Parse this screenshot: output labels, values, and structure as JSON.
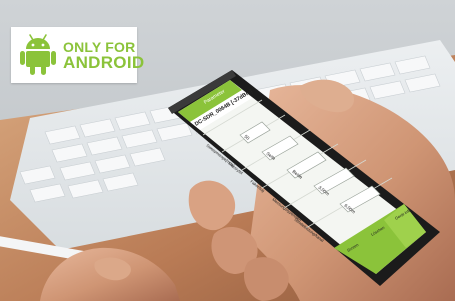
{
  "badge": {
    "line1": "ONLY FOR",
    "line2": "ANDROID",
    "color": "#8bc33a"
  },
  "phone": {
    "header_title": "Parameter",
    "device_name": "DC-SDR_0064B [-37dBm]",
    "rows": [
      {
        "label": "Sweepmenge[m³/s]",
        "value": "50"
      },
      {
        "label": "Messrytel",
        "value": "Seite"
      },
      {
        "label": "Fakor/tug",
        "value": "Beide"
      },
      {
        "label": "Messungstypenwert",
        "value": "3,00m"
      },
      {
        "label": "Sendeleistung/kanal",
        "value": "6,00m"
      }
    ],
    "bottom_buttons": [
      "Screen",
      "Löschen",
      "Gerät info"
    ],
    "accent_color": "#8bc33a"
  }
}
